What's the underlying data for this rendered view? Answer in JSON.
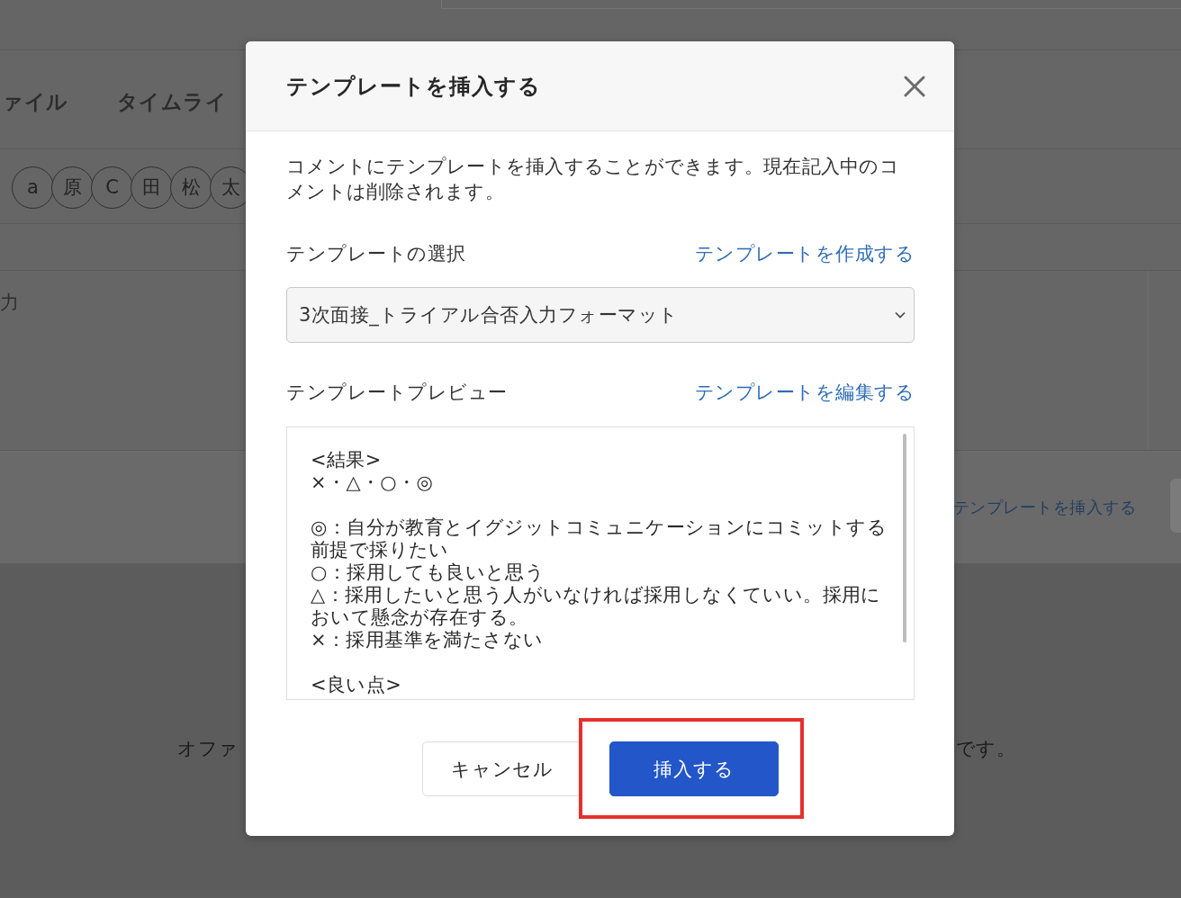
{
  "background": {
    "tabs": [
      {
        "label": "ァイル"
      },
      {
        "label": "タイムライ"
      }
    ],
    "members": [
      "a",
      "原",
      "C",
      "田",
      "松",
      "太"
    ],
    "comment_field": {
      "placeholder": "力"
    },
    "insert_template_link": "テンプレートを挿入する",
    "notice": {
      "left": "オファ",
      "right": "です。"
    }
  },
  "dialog": {
    "title": "テンプレートを挿入する",
    "description": "コメントにテンプレートを挿入することができます。現在記入中のコメントは削除されます。",
    "template_select": {
      "label": "テンプレートの選択",
      "link": "テンプレートを作成する",
      "value": "3次面接_トライアル合否入力フォーマット"
    },
    "preview": {
      "label": "テンプレートプレビュー",
      "link": "テンプレートを編集する",
      "value": "<結果>\n×・△・○・◎\n\n◎：自分が教育とイグジットコミュニケーションにコミットする前提で採りたい\n○：採用しても良いと思う\n△：採用したいと思う人がいなければ採用しなくていい。採用において懸念が存在する。\n×：採用基準を満たさない\n\n<良い点>"
    },
    "buttons": [
      {
        "label": "キャンセル",
        "kind": "secondary",
        "highlighted": false
      },
      {
        "label": "挿入する",
        "kind": "primary",
        "highlighted": true
      }
    ]
  }
}
